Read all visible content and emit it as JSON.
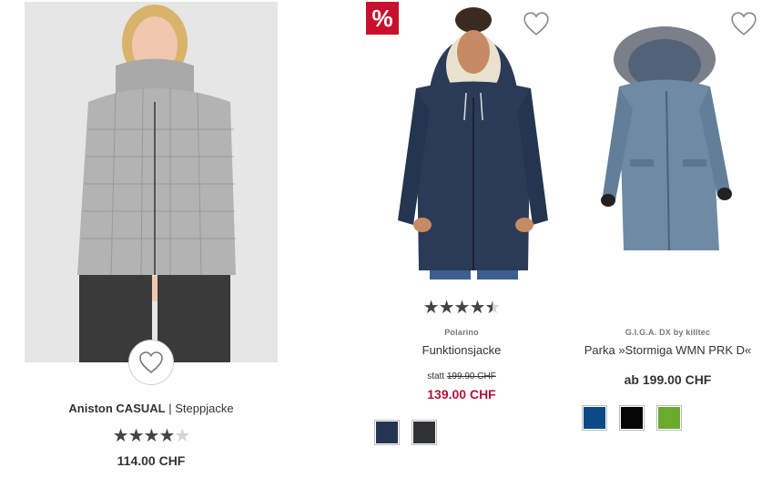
{
  "colors": {
    "sale_red": "#b5113a",
    "badge_red": "#c8102e",
    "star_on": "#444444",
    "star_off": "#d4d4d4"
  },
  "products": [
    {
      "brand": "Aniston CASUAL",
      "separator": "|",
      "title": "Steppjacke",
      "price": "114.00 CHF",
      "rating_stars": 4,
      "rating_max": 5,
      "favorite_icon": "heart-outline-icon",
      "image": "model wearing grey checked quilted jacket"
    },
    {
      "sale_badge": "%",
      "brand": "Polarino",
      "title": "Funktionsjacke",
      "old_price_prefix": "statt",
      "old_price": "199.90 CHF",
      "price": "139.00 CHF",
      "rating_stars": 4.5,
      "rating_max": 5,
      "favorite_icon": "heart-outline-icon",
      "swatches": [
        {
          "name": "navy",
          "color": "#243550"
        },
        {
          "name": "anthracite",
          "color": "#2f3336"
        }
      ]
    },
    {
      "brand": "G.I.G.A. DX by killtec",
      "title": "Parka »Stormiga WMN PRK D«",
      "price": "ab 199.00 CHF",
      "favorite_icon": "heart-outline-icon",
      "swatches": [
        {
          "name": "blue",
          "color": "#0c4a86"
        },
        {
          "name": "black",
          "color": "#050505"
        },
        {
          "name": "green",
          "color": "#6aab2e"
        }
      ]
    }
  ]
}
